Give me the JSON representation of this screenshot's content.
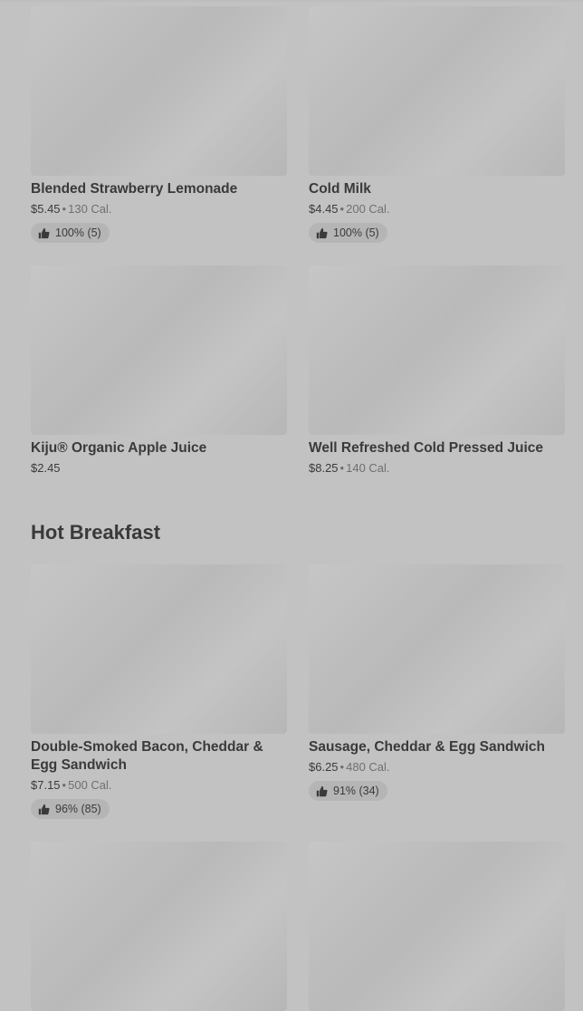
{
  "sections": [
    {
      "title": "",
      "items": [
        {
          "name": "Blended Strawberry Lemonade",
          "price": "$5.45",
          "calories": "130 Cal.",
          "rating": "100% (5)"
        },
        {
          "name": "Cold Milk",
          "price": "$4.45",
          "calories": "200 Cal.",
          "rating": "100% (5)"
        },
        {
          "name": "Kiju® Organic Apple Juice",
          "price": "$2.45",
          "calories": "",
          "rating": ""
        },
        {
          "name": "Well Refreshed Cold Pressed Juice",
          "price": "$8.25",
          "calories": "140 Cal.",
          "rating": ""
        }
      ]
    },
    {
      "title": "Hot Breakfast",
      "items": [
        {
          "name": "Double-Smoked Bacon, Cheddar & Egg Sandwich",
          "price": "$7.15",
          "calories": "500 Cal.",
          "rating": "96% (85)"
        },
        {
          "name": "Sausage, Cheddar & Egg Sandwich",
          "price": "$6.25",
          "calories": "480 Cal.",
          "rating": "91% (34)"
        }
      ]
    }
  ],
  "separator": "•",
  "icons": {
    "rating": "thumbs-up-icon"
  }
}
